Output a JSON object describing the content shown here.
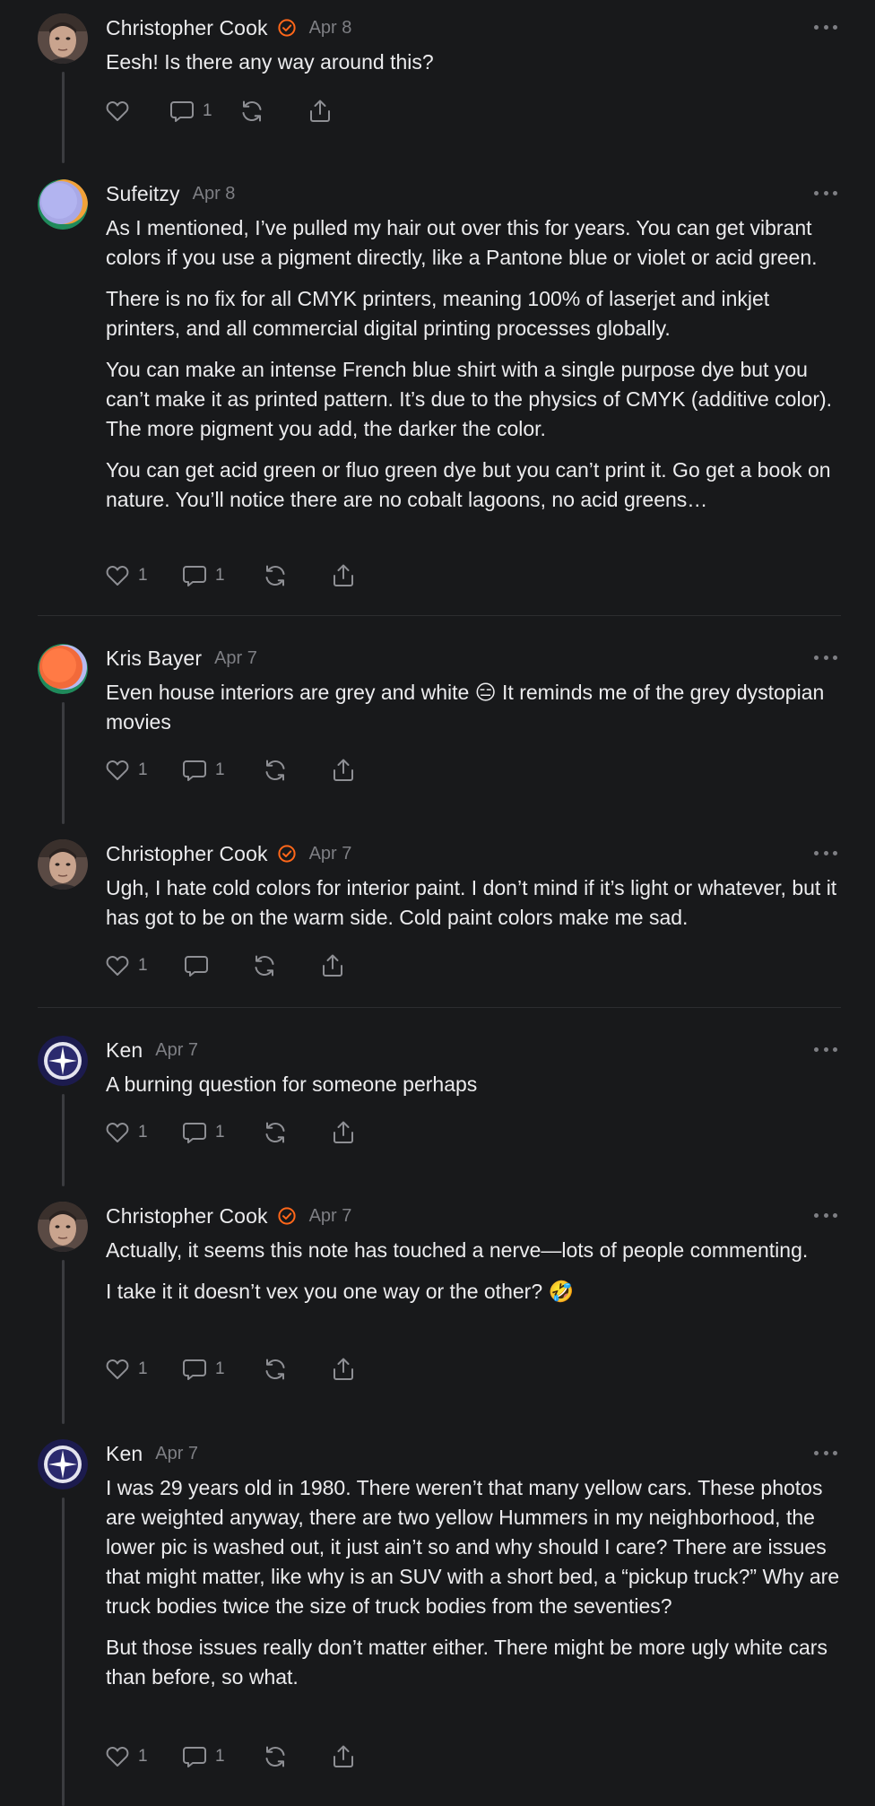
{
  "colors": {
    "background": "#18191b",
    "text": "#ececee",
    "muted": "#7e7f84",
    "verified_badge": "#ff6719",
    "thread_line": "#3b3c40"
  },
  "comments": [
    {
      "author": "Christopher Cook",
      "verified": true,
      "date": "Apr 8",
      "avatar": "photo-avatar",
      "paragraphs": [
        "Eesh! Is there any way around this?"
      ],
      "likes": "",
      "replies": "1",
      "icons": [
        "heart-icon",
        "comment-icon",
        "restack-icon",
        "share-icon"
      ]
    },
    {
      "author": "Sufeitzy",
      "verified": false,
      "date": "Apr 8",
      "avatar": "gradient-avatar-lavender",
      "paragraphs": [
        "As I mentioned, I’ve pulled my hair out over this for years. You can get vibrant colors if you use a pigment directly, like a Pantone blue or violet or acid green.",
        "There is no fix for all CMYK printers, meaning 100% of laserjet and inkjet printers, and all commercial digital printing processes globally.",
        "You can make an intense French blue shirt with a single purpose dye but you can’t make it as printed pattern. It’s due to the physics of CMYK (additive color). The more pigment you add, the darker the color.",
        "You can get acid green or fluo green dye but you can’t print it. Go get a book on nature. You’ll notice there are no cobalt lagoons, no acid greens…"
      ],
      "likes": "1",
      "replies": "1"
    },
    {
      "author": "Kris Bayer",
      "verified": false,
      "date": "Apr 7",
      "avatar": "gradient-avatar-orange",
      "paragraphs": [
        "Even house interiors are grey and white 😑 It reminds me of the grey dystopian movies"
      ],
      "likes": "1",
      "replies": "1"
    },
    {
      "author": "Christopher Cook",
      "verified": true,
      "date": "Apr 7",
      "avatar": "photo-avatar",
      "paragraphs": [
        "Ugh, I hate cold colors for interior paint. I don’t mind if it’s light or whatever, but it has got to be on the warm side. Cold paint colors make me sad."
      ],
      "likes": "1",
      "replies": ""
    },
    {
      "author": "Ken",
      "verified": false,
      "date": "Apr 7",
      "avatar": "star-avatar",
      "paragraphs": [
        "A burning question for someone perhaps"
      ],
      "likes": "1",
      "replies": "1"
    },
    {
      "author": "Christopher Cook",
      "verified": true,
      "date": "Apr 7",
      "avatar": "photo-avatar",
      "paragraphs": [
        "Actually, it seems this note has touched a nerve—lots of people commenting.",
        "I take it it doesn’t vex you one way or the other? 🤣"
      ],
      "likes": "1",
      "replies": "1"
    },
    {
      "author": "Ken",
      "verified": false,
      "date": "Apr 7",
      "avatar": "star-avatar",
      "paragraphs": [
        "I was 29 years old in 1980. There weren’t that many yellow cars. These photos are weighted anyway, there are two yellow Hummers in my neighborhood, the lower pic is washed out, it just ain’t so and why should I care? There are issues that might matter, like why is an SUV with a short bed, a “pickup truck?” Why are truck bodies twice the size of truck bodies from the seventies?",
        "But those issues really don’t matter either. There might be more ugly white cars than before, so what."
      ],
      "likes": "1",
      "replies": "1"
    }
  ]
}
